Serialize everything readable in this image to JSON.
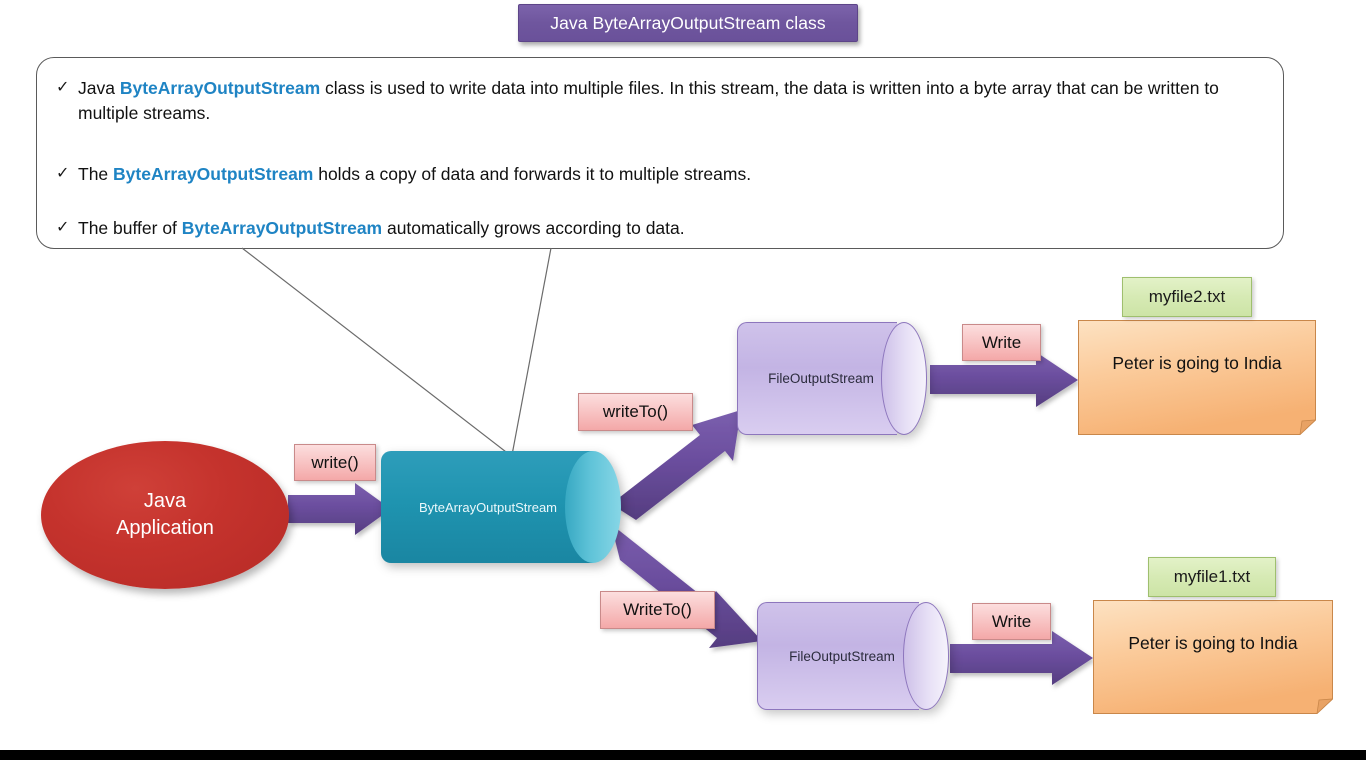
{
  "title": {
    "text": "Java ByteArrayOutputStream class",
    "bg_color": "#6f569e"
  },
  "callout": {
    "bullets": [
      {
        "marker": "✓",
        "parts": [
          {
            "text": "Java ",
            "bold": false
          },
          {
            "text": "ByteArrayOutputStream",
            "bold": true
          },
          {
            "text": " class is used to write data into multiple files. In this stream, the data is written into a byte array that can be written to multiple streams.",
            "bold": false
          }
        ]
      },
      {
        "marker": "✓",
        "parts": [
          {
            "text": "The ",
            "bold": false
          },
          {
            "text": "ByteArrayOutputStream",
            "bold": true
          },
          {
            "text": " holds a copy of data and forwards it to multiple streams.",
            "bold": false
          }
        ]
      },
      {
        "marker": "✓",
        "parts": [
          {
            "text": "The buffer of ",
            "bold": false
          },
          {
            "text": "ByteArrayOutputStream",
            "bold": true
          },
          {
            "text": " automatically grows according to data.",
            "bold": false
          }
        ]
      }
    ],
    "highlight_color": "#1f84c4"
  },
  "diagram": {
    "java_app": {
      "line1": "Java",
      "line2": "Application",
      "color": "#c5332d"
    },
    "baos": {
      "label": "ByteArrayOutputStream",
      "color": "#1f94b0"
    },
    "fos_top": {
      "label": "FileOutputStream",
      "color": "#c3b4e4"
    },
    "fos_bottom": {
      "label": "FileOutputStream",
      "color": "#c3b4e4"
    },
    "labels": {
      "write": "write()",
      "write_to_top": "writeTo()",
      "write_to_bottom": "WriteTo()",
      "write_file_top": "Write",
      "write_file_bottom": "Write",
      "pink_color": "#f4a8a8"
    },
    "files": {
      "top": {
        "name": "myfile2.txt",
        "content": "Peter is going to India"
      },
      "bottom": {
        "name": "myfile1.txt",
        "content": "Peter is going to India"
      },
      "name_color": "#cde4a6",
      "note_color": "#f7bd80"
    },
    "arrow_color": "#6b4e9e"
  }
}
